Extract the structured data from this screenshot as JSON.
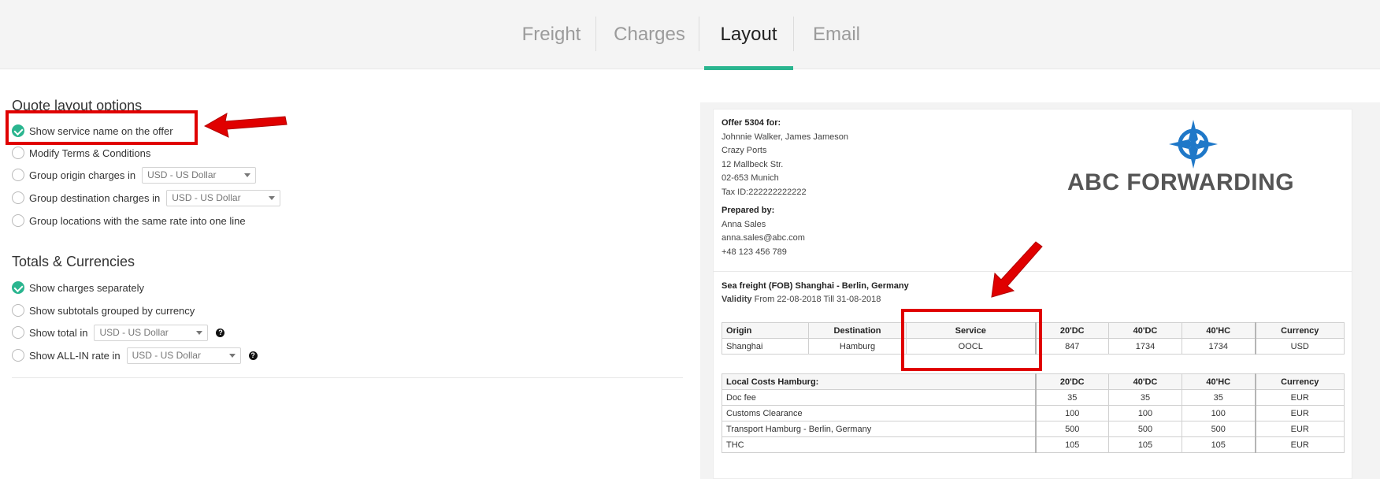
{
  "tabs": [
    {
      "label": "Freight",
      "active": false
    },
    {
      "label": "Charges",
      "active": false
    },
    {
      "label": "Layout",
      "active": true
    },
    {
      "label": "Email",
      "active": false
    }
  ],
  "accent_color": "#2ab58f",
  "annotation_color": "#e00000",
  "layout_options": {
    "title": "Quote layout options",
    "items": [
      {
        "label": "Show service name on the offer",
        "checked": true
      },
      {
        "label": "Modify Terms & Conditions",
        "checked": false
      },
      {
        "label": "Group origin charges in",
        "checked": false,
        "select": "USD - US Dollar"
      },
      {
        "label": "Group destination charges in",
        "checked": false,
        "select": "USD - US Dollar"
      },
      {
        "label": "Group locations with the same rate into one line",
        "checked": false
      }
    ]
  },
  "totals": {
    "title": "Totals & Currencies",
    "items": [
      {
        "label": "Show charges separately",
        "checked": true
      },
      {
        "label": "Show subtotals grouped by currency",
        "checked": false
      },
      {
        "label": "Show total in",
        "checked": false,
        "select": "USD - US Dollar",
        "help": "?"
      },
      {
        "label": "Show ALL-IN rate in",
        "checked": false,
        "select": "USD - US Dollar",
        "help": "?"
      }
    ]
  },
  "preview": {
    "offer_for_label": "Offer 5304 for:",
    "client_lines": [
      "Johnnie Walker, James Jameson",
      "Crazy Ports",
      "12 Mallbeck Str.",
      "02-653 Munich",
      "Tax ID:222222222222"
    ],
    "prepared_by_label": "Prepared by:",
    "prepared_lines": [
      "Anna Sales",
      "anna.sales@abc.com",
      "+48 123 456 789"
    ],
    "logo_text": "ABC FORWARDING",
    "route_title": "Sea freight (FOB) Shanghai - Berlin, Germany",
    "validity_label": "Validity",
    "validity_text": "From 22-08-2018 Till 31-08-2018",
    "freight_table": {
      "headers": [
        "Origin",
        "Destination",
        "Service",
        "20'DC",
        "40'DC",
        "40'HC",
        "Currency"
      ],
      "rows": [
        [
          "Shanghai",
          "Hamburg",
          "OOCL",
          "847",
          "1734",
          "1734",
          "USD"
        ]
      ]
    },
    "local_table": {
      "headers": [
        "Local Costs Hamburg:",
        "20'DC",
        "40'DC",
        "40'HC",
        "Currency"
      ],
      "rows": [
        [
          "Doc fee",
          "35",
          "35",
          "35",
          "EUR"
        ],
        [
          "Customs Clearance",
          "100",
          "100",
          "100",
          "EUR"
        ],
        [
          "Transport Hamburg - Berlin, Germany",
          "500",
          "500",
          "500",
          "EUR"
        ],
        [
          "THC",
          "105",
          "105",
          "105",
          "EUR"
        ]
      ]
    }
  }
}
